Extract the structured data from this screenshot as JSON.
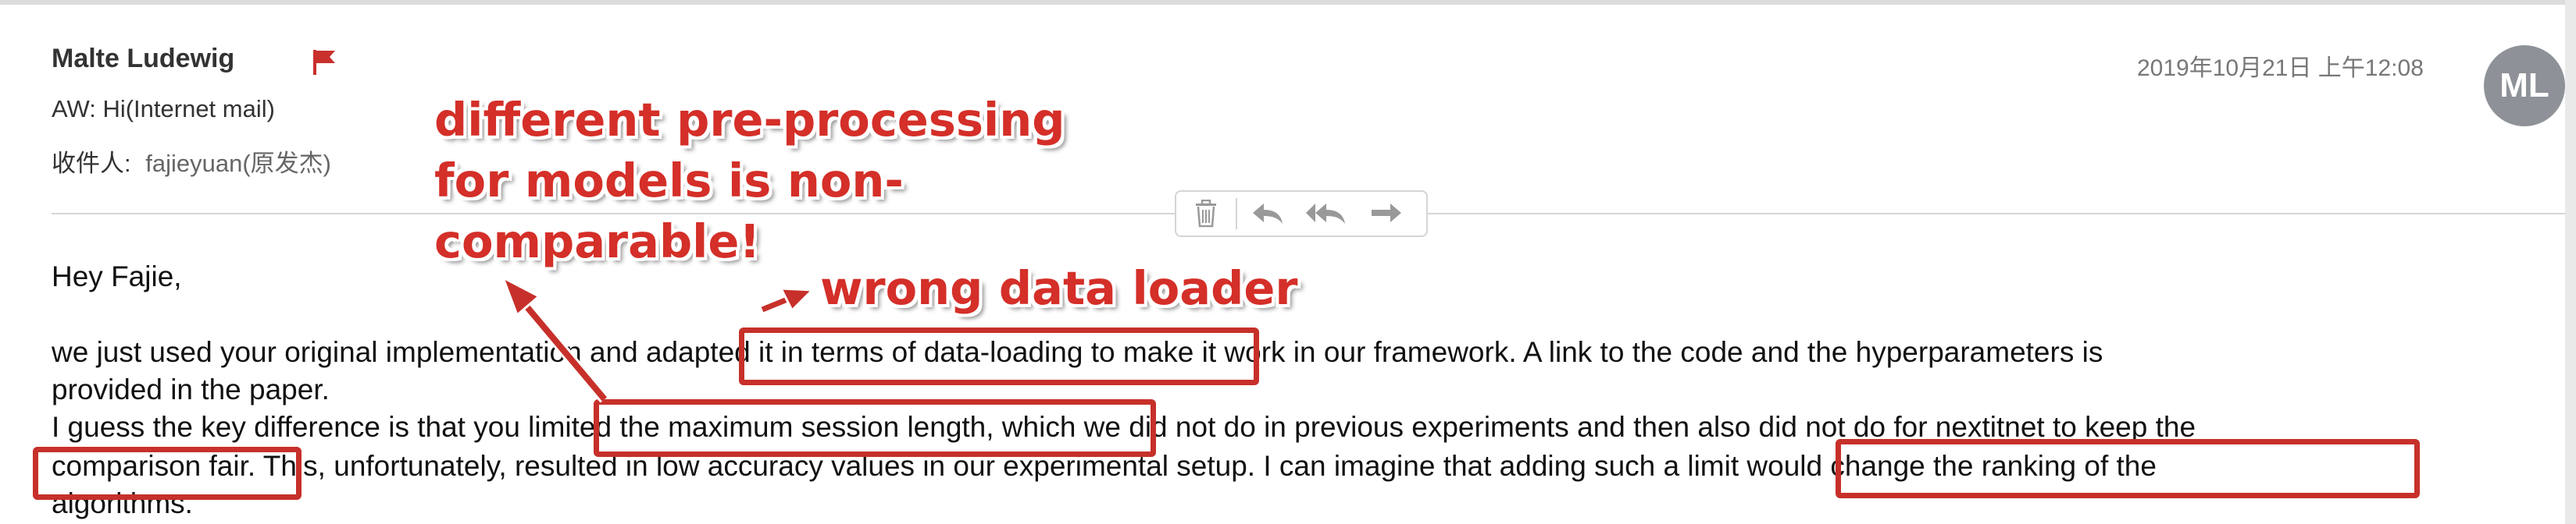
{
  "email": {
    "sender": "Malte Ludewig",
    "subject": "AW: Hi(Internet mail)",
    "recipient_label": "收件人:",
    "recipient": "fajieyuan(原发杰)",
    "datetime": "2019年10月21日 上午12:08",
    "avatar_initials": "ML"
  },
  "toolbar": {
    "icons": [
      "trash-icon",
      "reply-icon",
      "reply-all-icon",
      "forward-icon"
    ]
  },
  "body": {
    "greeting": "Hey Fajie,",
    "line1": "we just used your original implementation and adapted it in terms of data-loading to make it work in our framework. A link to the code and the hyperparameters is",
    "line2": "provided in the paper.",
    "line3": "I guess the key difference is that you limited the maximum session length, which we did not do in previous experiments and then also did not do for nextitnet to keep the",
    "line4": "comparison fair. This, unfortunately, resulted in low accuracy values in our experimental setup. I can imagine that adding such a limit would change the ranking of the",
    "line5": "algorithms."
  },
  "annotations": {
    "note1_line1": "different pre-processing",
    "note1_line2": "for models  is non-",
    "note1_line3": "comparable!",
    "note2": "wrong data loader",
    "color": "#d42f28"
  }
}
